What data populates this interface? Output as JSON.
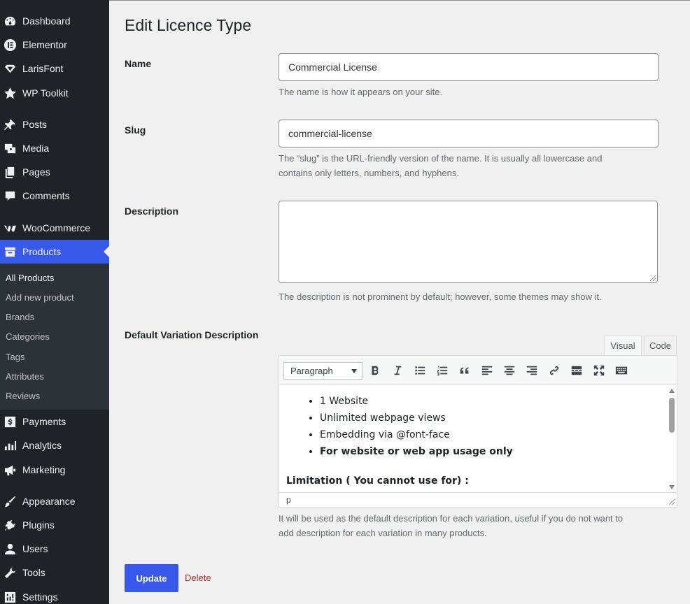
{
  "sidebar": {
    "items": [
      {
        "label": "Dashboard",
        "icon": "dashboard-icon"
      },
      {
        "label": "Elementor",
        "icon": "elementor-icon"
      },
      {
        "label": "LarisFont",
        "icon": "diamond-icon"
      },
      {
        "label": "WP Toolkit",
        "icon": "star-icon"
      },
      {
        "label": "Posts",
        "icon": "pin-icon"
      },
      {
        "label": "Media",
        "icon": "media-icon"
      },
      {
        "label": "Pages",
        "icon": "pages-icon"
      },
      {
        "label": "Comments",
        "icon": "comment-icon"
      },
      {
        "label": "WooCommerce",
        "icon": "woocommerce-icon"
      },
      {
        "label": "Products",
        "icon": "archive-icon"
      },
      {
        "label": "Payments",
        "icon": "dollar-icon"
      },
      {
        "label": "Analytics",
        "icon": "bar-chart-icon"
      },
      {
        "label": "Marketing",
        "icon": "megaphone-icon"
      },
      {
        "label": "Appearance",
        "icon": "brush-icon"
      },
      {
        "label": "Plugins",
        "icon": "plug-icon"
      },
      {
        "label": "Users",
        "icon": "user-icon"
      },
      {
        "label": "Tools",
        "icon": "wrench-icon"
      },
      {
        "label": "Settings",
        "icon": "settings-icon"
      }
    ],
    "active": "Products",
    "submenu": [
      "All Products",
      "Add new product",
      "Brands",
      "Categories",
      "Tags",
      "Attributes",
      "Reviews"
    ]
  },
  "page": {
    "title": "Edit Licence Type"
  },
  "form": {
    "name": {
      "label": "Name",
      "value": "Commercial License",
      "help": "The name is how it appears on your site."
    },
    "slug": {
      "label": "Slug",
      "value": "commercial-license",
      "help_line1": "The “slug” is the URL-friendly version of the name. It is usually all lowercase and",
      "help_line2": "contains only letters, numbers, and hyphens."
    },
    "description": {
      "label": "Description",
      "value": "",
      "help": "The description is not prominent by default; however, some themes may show it."
    },
    "default_variation": {
      "label": "Default Variation Description",
      "tabs": {
        "visual": "Visual",
        "code": "Code"
      },
      "format": "Paragraph",
      "content_list": [
        "1 Website",
        "Unlimited webpage views",
        "Embedding via @font-face",
        "For website or web app usage only"
      ],
      "content_heading": "Limitation ( You cannot use for) :",
      "status_path": "p",
      "help_line1": "It will be used as the default description for each variation, useful if you do not want to",
      "help_line2": "add description for each variation in many products."
    }
  },
  "actions": {
    "update": "Update",
    "delete": "Delete"
  },
  "colors": {
    "sidebar_bg": "#1d2327",
    "accent": "#3858e9",
    "delete": "#b32d2e",
    "page_bg": "#f0f0f1"
  }
}
